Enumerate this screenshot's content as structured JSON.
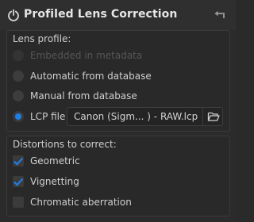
{
  "panel": {
    "title": "Profiled Lens Correction",
    "icons": {
      "power": "power-icon",
      "reset": "reset-icon"
    }
  },
  "lens_profile": {
    "label": "Lens profile:",
    "options": [
      {
        "label": "Embedded in metadata",
        "selected": false,
        "disabled": true
      },
      {
        "label": "Automatic from database",
        "selected": false,
        "disabled": false
      },
      {
        "label": "Manual from database",
        "selected": false,
        "disabled": false
      },
      {
        "label": "LCP file",
        "selected": true,
        "disabled": false
      }
    ],
    "lcp_file_value": "Canon (Sigm... ) - RAW.lcp",
    "browse_icon": "folder-open-icon"
  },
  "distortions": {
    "label": "Distortions to correct:",
    "items": [
      {
        "label": "Geometric",
        "checked": true
      },
      {
        "label": "Vignetting",
        "checked": true
      },
      {
        "label": "Chromatic aberration",
        "checked": false
      }
    ]
  },
  "colors": {
    "accent": "#1e7fe6",
    "background": "#2b2b2b",
    "text": "#cfcfcf"
  }
}
